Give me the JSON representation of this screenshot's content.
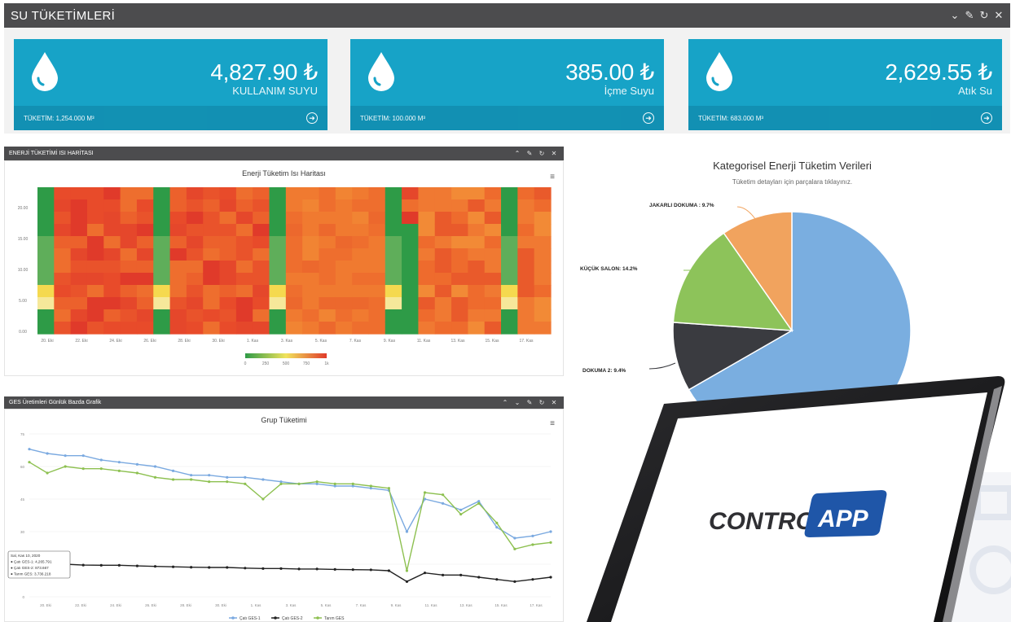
{
  "water": {
    "title": "SU TÜKETİMLERİ",
    "cards": [
      {
        "amount": "4,827.90 ₺",
        "label": "KULLANIM SUYU",
        "foot": "TÜKETİM: 1,254.000 M³"
      },
      {
        "amount": "385.00 ₺",
        "label": "İçme Suyu",
        "foot": "TÜKETİM: 100.000 M³"
      },
      {
        "amount": "2,629.55 ₺",
        "label": "Atık Su",
        "foot": "TÜKETİM: 683.000 M³"
      }
    ],
    "accent": "#17a3c7"
  },
  "heatmap_panel": {
    "bar_title": "ENERJİ TÜKETİMİ ISI HARİTASI",
    "chart_title": "Enerji Tüketim Isı Haritası",
    "y_ticks": [
      "20.00",
      "15.00",
      "10.00",
      "5.00",
      "0.00"
    ],
    "x_ticks": [
      "20. Eki",
      "22. Eki",
      "24. Eki",
      "26. Eki",
      "28. Eki",
      "30. Eki",
      "1. Kas",
      "3. Kas",
      "5. Kas",
      "7. Kas",
      "9. Kas",
      "11. Kas",
      "13. Kas",
      "15. Kas",
      "17. Kas"
    ],
    "legend_ticks": [
      "0",
      "250",
      "500",
      "750",
      "1k"
    ]
  },
  "line_panel": {
    "bar_title": "GES Üretimleri Günlük Bazda Grafik",
    "chart_title": "Grup Tüketimi",
    "tooltip": [
      "Sal, Kas 10, 2020",
      "● Çatı GES-1: 4,265.791",
      "● Çatı GES-2: 873.667",
      "● Tarım GES: 3,736.218"
    ]
  },
  "pie_panel": {
    "title": "Kategorisel Enerji Tüketim Verileri",
    "subtitle": "Tüketim detayları için parçalara tıklayınız.",
    "labels": [
      "JAKARLI DOKUMA : 9.7%",
      "KÜÇÜK SALON: 14.2%",
      "DOKUMA 2: 9.4%"
    ]
  },
  "brand": {
    "word1": "CONTROL",
    "word2": "APP"
  },
  "chart_data": [
    {
      "type": "heatmap",
      "title": "Enerji Tüketim Isı Haritası",
      "x_categories": [
        "20. Eki",
        "22. Eki",
        "24. Eki",
        "26. Eki",
        "28. Eki",
        "30. Eki",
        "1. Kas",
        "3. Kas",
        "5. Kas",
        "7. Kas",
        "9. Kas",
        "11. Kas",
        "13. Kas",
        "15. Kas",
        "17. Kas"
      ],
      "ylim": [
        0,
        24
      ],
      "color_scale": [
        "#2e9b47",
        "#f1e35c",
        "#e03a2a"
      ],
      "low_columns": [
        0,
        7,
        14,
        21,
        28
      ]
    },
    {
      "type": "line",
      "title": "Grup Tüketimi",
      "x": [
        "20. Eki",
        "22. Eki",
        "24. Eki",
        "26. Eki",
        "28. Eki",
        "30. Eki",
        "1. Kas",
        "3. Kas",
        "5. Kas",
        "7. Kas",
        "9. Kas",
        "11. Kas",
        "13. Kas",
        "15. Kas",
        "17. Kas"
      ],
      "ylim": [
        0,
        75
      ],
      "series": [
        {
          "name": "Çatı GES-1",
          "color": "#7aa9e0",
          "values": [
            68,
            66,
            65,
            65,
            63,
            62,
            61,
            60,
            58,
            56,
            56,
            55,
            55,
            54,
            53,
            52,
            52,
            51,
            51,
            50,
            49,
            30,
            45,
            43,
            40,
            44,
            32,
            27,
            28,
            30
          ]
        },
        {
          "name": "Çatı GES-2",
          "color": "#222222",
          "values": [
            15,
            15,
            15,
            14.6,
            14.5,
            14.5,
            14.2,
            14,
            13.8,
            13.6,
            13.5,
            13.5,
            13.2,
            13,
            13,
            12.8,
            12.8,
            12.6,
            12.5,
            12.4,
            12,
            7,
            11,
            10,
            10,
            9,
            8,
            7,
            8,
            9
          ]
        },
        {
          "name": "Tarım GES",
          "color": "#8dc050",
          "values": [
            62,
            57,
            60,
            59,
            59,
            58,
            57,
            55,
            54,
            54,
            53,
            53,
            52,
            45,
            52,
            52,
            53,
            52,
            52,
            51,
            50,
            12,
            48,
            47,
            38,
            43,
            34,
            22,
            24,
            25
          ]
        }
      ]
    },
    {
      "type": "pie",
      "title": "Kategorisel Enerji Tüketim Verileri",
      "slices": [
        {
          "name": "",
          "value": 66.7,
          "color": "#7aaee0"
        },
        {
          "name": "DOKUMA 2",
          "value": 9.4,
          "color": "#3a3b40"
        },
        {
          "name": "KÜÇÜK SALON",
          "value": 14.2,
          "color": "#8dc35a"
        },
        {
          "name": "JAKARLI DOKUMA",
          "value": 9.7,
          "color": "#f1a35e"
        }
      ]
    }
  ]
}
